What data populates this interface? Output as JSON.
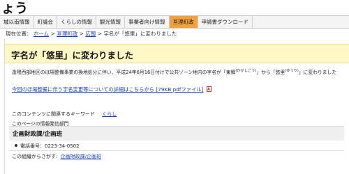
{
  "header": {
    "site_title": "ょう"
  },
  "nav": {
    "items": [
      {
        "label": "城以南情報"
      },
      {
        "label": "町議会"
      },
      {
        "label": "くらしの情報"
      },
      {
        "label": "観光情報"
      },
      {
        "label": "事業者向け情報"
      },
      {
        "label": "亘理町政",
        "active": true
      },
      {
        "label": "申請書ダウンロード"
      }
    ]
  },
  "breadcrumb": {
    "prefix": "現在位置：",
    "items": [
      "ホーム",
      "亘理町政",
      "広報"
    ],
    "separator": ">",
    "current": "字名が「悠里」に変わりました"
  },
  "page": {
    "title": "字名が「悠里」に変わりました",
    "body_before": "逢隈西部地区のほ場整備事業の換地処分に伴い、平成24年6月16日付けで公共ゾーン地内の字名が「東郷",
    "ruby_1": "(ひがしごう)",
    "body_middle": "」から「悠里",
    "ruby_2": "(ゆうり)",
    "body_after": "」に変わりました",
    "detail_link": "今回のほ場整備に伴う字名変更等についての詳細はこちらから [79KB pdfファイル]",
    "pdf_icon": "pdf-file-icon"
  },
  "keywords": {
    "label": "このコンテンツに関連するキーワード",
    "items": [
      "くらし"
    ]
  },
  "department": {
    "caption": "このページの情報発信部門",
    "name": "企画財政課/企画班",
    "phone": "電話番号：0223-34-0502"
  },
  "org_search": {
    "label": "この組織からさがす:",
    "link": "企画財政課/企画班"
  },
  "colors": {
    "nav_active": "#f3a23b",
    "title_band": "#fff7c6",
    "link": "#1a3fc2"
  }
}
